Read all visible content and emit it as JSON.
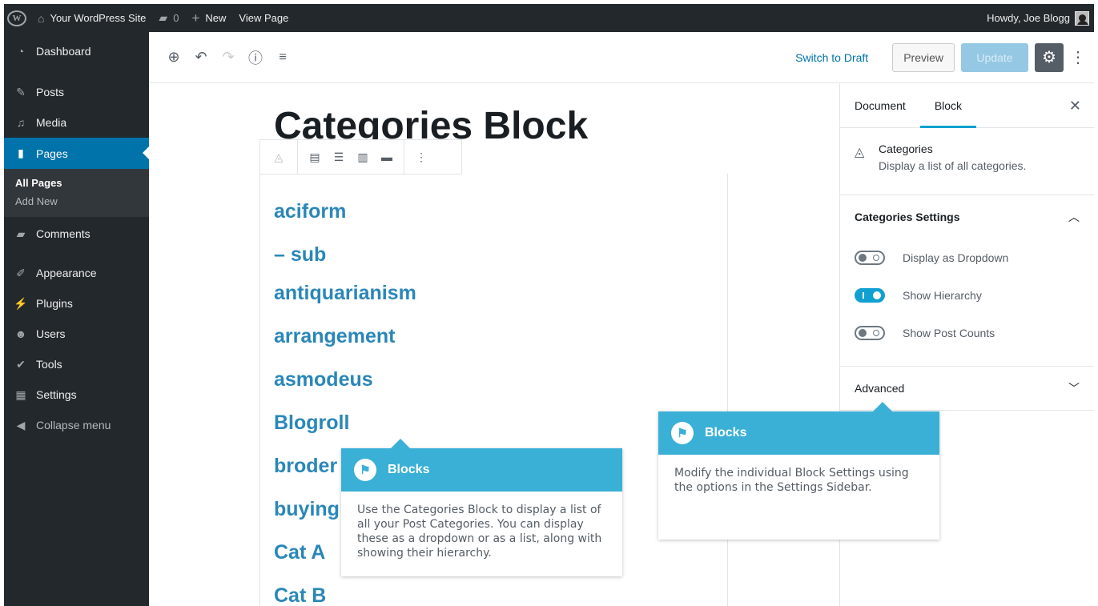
{
  "admin_bar": {
    "site_name": "Your WordPress Site",
    "comments_count": "0",
    "new_label": "New",
    "view_page_label": "View Page",
    "greeting": "Howdy, Joe Blogg"
  },
  "sidebar": {
    "items": [
      {
        "label": "Dashboard",
        "icon": "dashboard-icon"
      },
      {
        "label": "Posts",
        "icon": "pin-icon"
      },
      {
        "label": "Media",
        "icon": "media-icon"
      },
      {
        "label": "Pages",
        "icon": "page-icon"
      },
      {
        "label": "Comments",
        "icon": "comment-icon"
      },
      {
        "label": "Appearance",
        "icon": "brush-icon"
      },
      {
        "label": "Plugins",
        "icon": "plugin-icon"
      },
      {
        "label": "Users",
        "icon": "users-icon"
      },
      {
        "label": "Tools",
        "icon": "wrench-icon"
      },
      {
        "label": "Settings",
        "icon": "settings-icon"
      },
      {
        "label": "Collapse menu",
        "icon": "collapse-icon"
      }
    ],
    "submenu": {
      "all_pages": "All Pages",
      "add_new": "Add New"
    }
  },
  "header": {
    "switch_to_draft": "Switch to Draft",
    "preview": "Preview",
    "update": "Update"
  },
  "editor": {
    "title": "Categories Block",
    "categories": [
      "aciform",
      "– sub",
      "antiquarianism",
      "arrangement",
      "asmodeus",
      "Blogroll",
      "broder",
      "buying",
      "Cat A",
      "Cat B"
    ]
  },
  "settings": {
    "tab_document": "Document",
    "tab_block": "Block",
    "block_name": "Categories",
    "block_desc": "Display a list of all categories.",
    "panel_title": "Categories Settings",
    "toggles": [
      {
        "label": "Display as Dropdown",
        "on": false
      },
      {
        "label": "Show Hierarchy",
        "on": true
      },
      {
        "label": "Show Post Counts",
        "on": false
      }
    ],
    "advanced": "Advanced"
  },
  "tooltips": [
    {
      "title": "Blocks",
      "body": "Use the Categories Block to display a list of all your Post Categories. You can display these as a dropdown or as a list, along with showing their hierarchy."
    },
    {
      "title": "Blocks",
      "body": "Modify the individual Block Settings using the options in the Settings Sidebar."
    }
  ],
  "colors": {
    "accent": "#0073aa",
    "admin_bg": "#23282d",
    "tooltip_header": "#3ab0d7",
    "category_link": "#2a87b8"
  }
}
